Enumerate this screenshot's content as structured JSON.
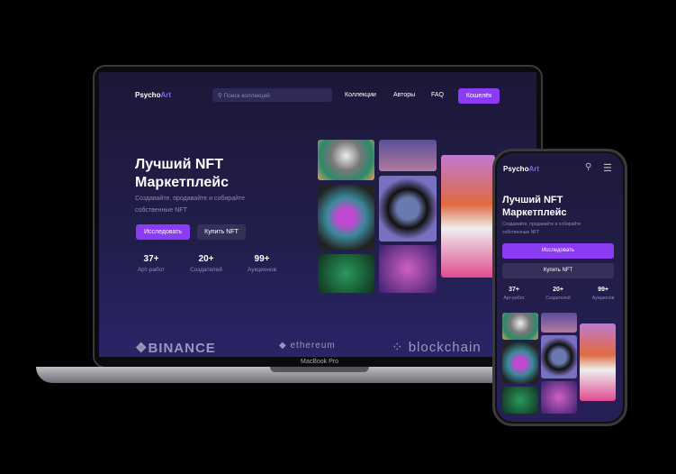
{
  "laptop": {
    "logo": {
      "part1": "Psycho",
      "part2": "Art"
    },
    "search_placeholder": "Поиск коллекций",
    "nav": [
      "Коллекции",
      "Авторы",
      "FAQ"
    ],
    "wallet_button": "Кошелёк",
    "hero": {
      "title_line1": "Лучший NFT",
      "title_line2": "Маркетплейс",
      "subtitle_line1": "Создавайте, продавайте и собирайте",
      "subtitle_line2": "собственные NFT",
      "explore_button": "Исследовать",
      "buy_button": "Купить NFT"
    },
    "stats": [
      {
        "value": "37+",
        "label": "Арт-работ"
      },
      {
        "value": "20+",
        "label": "Создателей"
      },
      {
        "value": "99+",
        "label": "Аукционов"
      }
    ],
    "partners": [
      "BINANCE",
      "ethereum",
      "blockchain"
    ],
    "device_label": "MacBook Pro"
  },
  "phone": {
    "logo": {
      "part1": "Psycho",
      "part2": "Art"
    },
    "hero": {
      "title_line1": "Лучший NFT",
      "title_line2": "Маркетплейс",
      "subtitle_line1": "Создавайте, продавайте и собирайте",
      "subtitle_line2": "собственные NFT",
      "explore_button": "Исследовать",
      "buy_button": "Купить NFT"
    },
    "stats": [
      {
        "value": "37+",
        "label": "Арт-работ"
      },
      {
        "value": "20+",
        "label": "Создателей"
      },
      {
        "value": "99+",
        "label": "Аукционов"
      }
    ]
  },
  "colors": {
    "accent": "#8b3cf2",
    "background": "#1e1a3e"
  }
}
